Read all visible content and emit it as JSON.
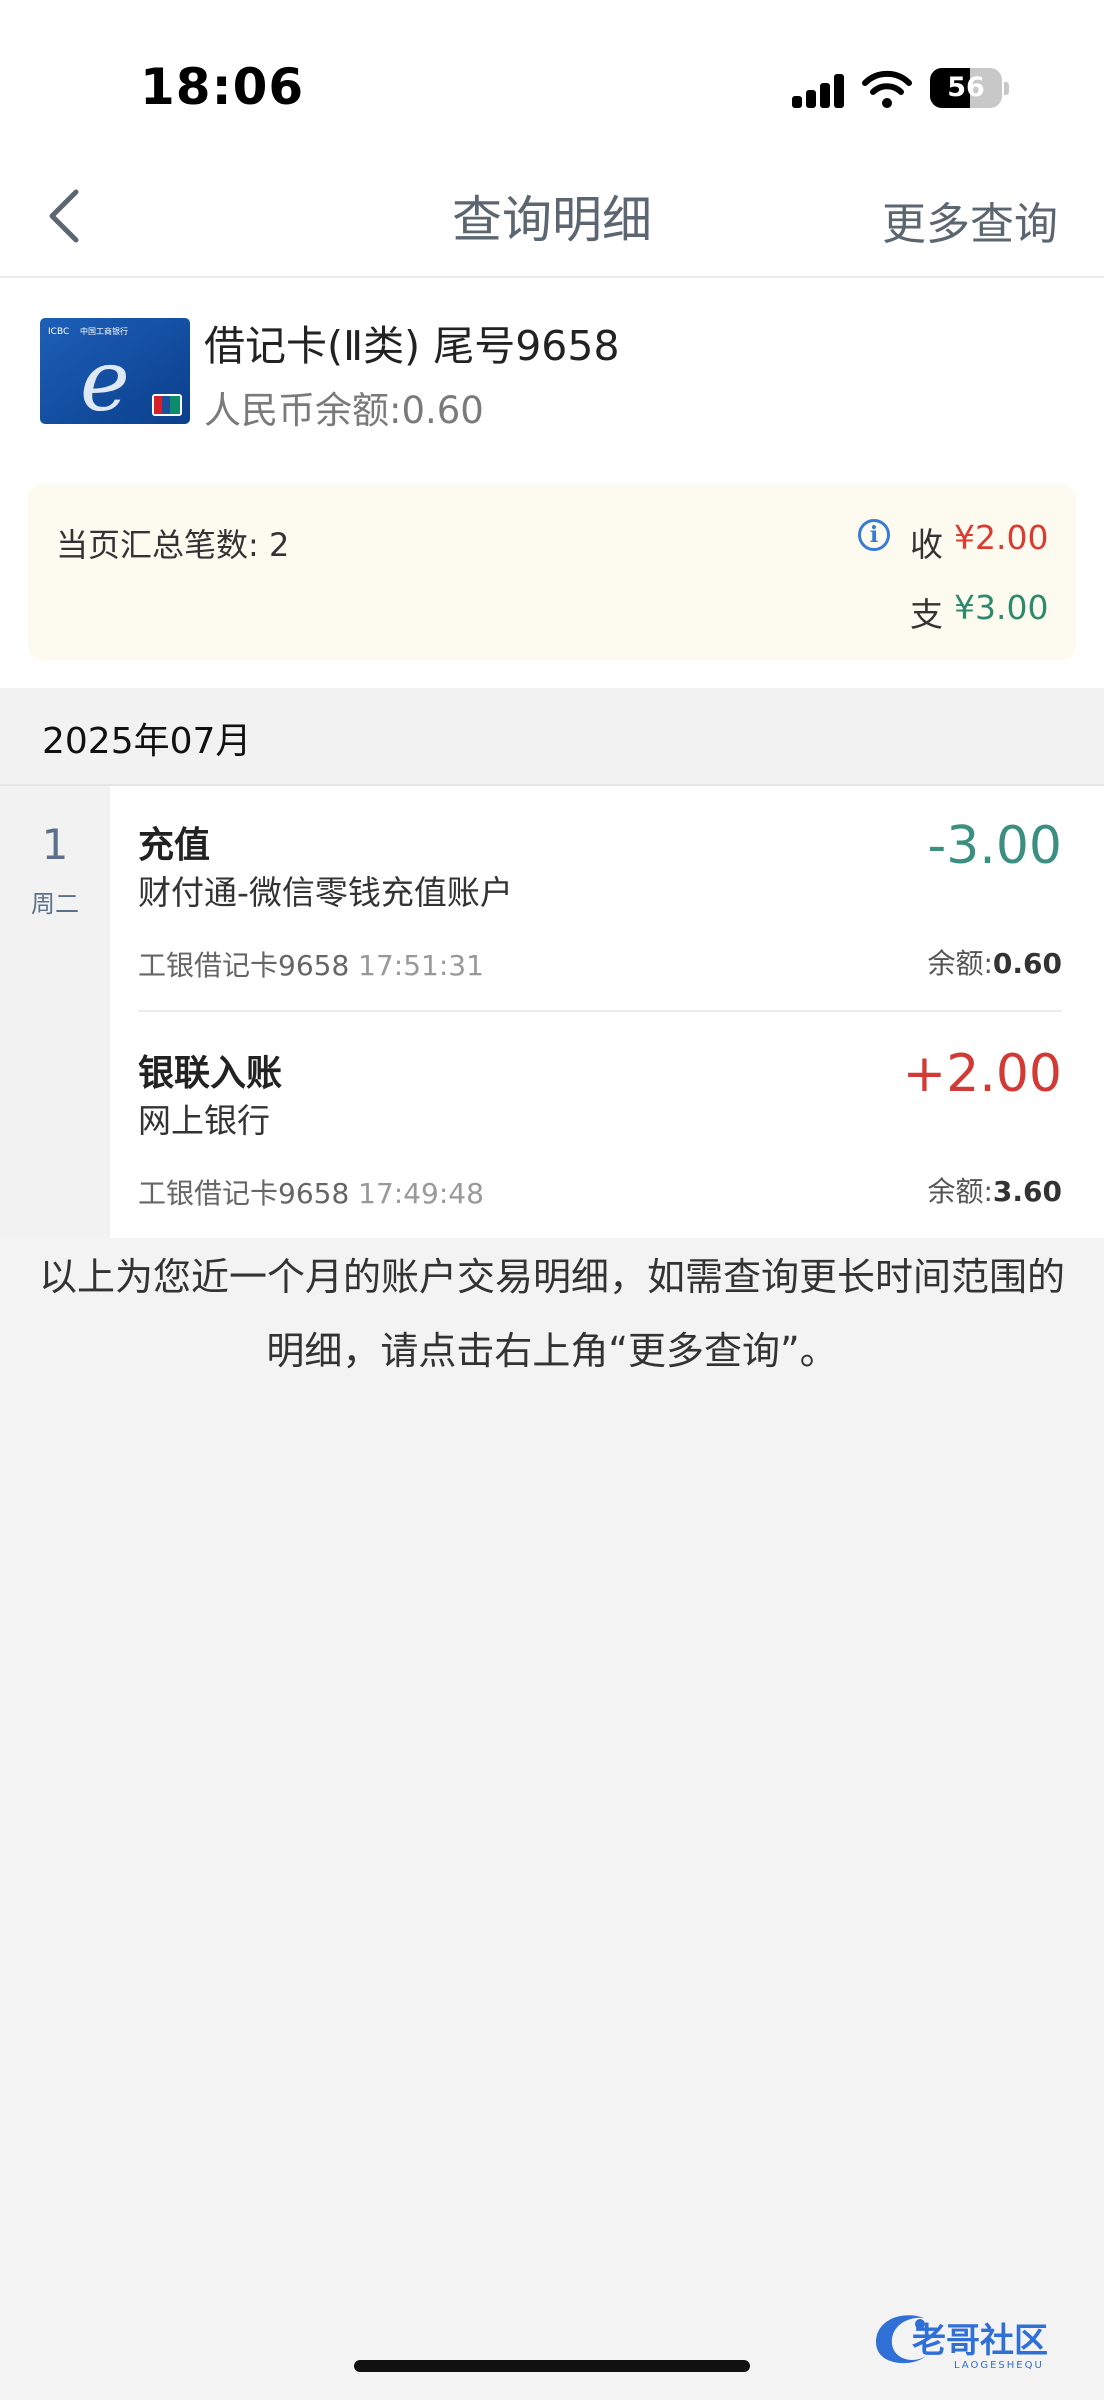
{
  "status_bar": {
    "time": "18:06",
    "battery": "56",
    "battery_level": 0.56
  },
  "nav": {
    "title": "查询明细",
    "more_label": "更多查询"
  },
  "account": {
    "card_type": "借记卡(Ⅱ类) 尾号9658",
    "balance": "人民币余额:0.60",
    "card_logo_text": "ICBC 中国工商银行"
  },
  "summary": {
    "count": "当页汇总笔数: 2",
    "income_label": "收",
    "income_value": "¥2.00",
    "expense_label": "支",
    "expense_value": "¥3.00"
  },
  "month": "2025年07月",
  "day": {
    "number": "1",
    "weekday": "周二"
  },
  "transactions": [
    {
      "title": "充值",
      "subtitle": "财付通-微信零钱充值账户",
      "card": "工银借记卡9658",
      "time": "17:51:31",
      "amount": "-3.00",
      "balance_label": "余额:",
      "balance_value": "0.60"
    },
    {
      "title": "银联入账",
      "subtitle": "网上银行",
      "card": "工银借记卡9658",
      "time": "17:49:48",
      "amount": "+2.00",
      "balance_label": "余额:",
      "balance_value": "3.60"
    }
  ],
  "footer_note": "以上为您近一个月的账户交易明细，如需查询更长时间范围的明细，请点击右上角“更多查询”。",
  "watermark": {
    "text": "老哥社区",
    "sub": "LAOGESHEQU"
  },
  "colors": {
    "income_red": "#dd3b30",
    "expense_green": "#2e8a6c",
    "amount_negative": "#3a8f80",
    "nav_text": "#5c6670"
  }
}
